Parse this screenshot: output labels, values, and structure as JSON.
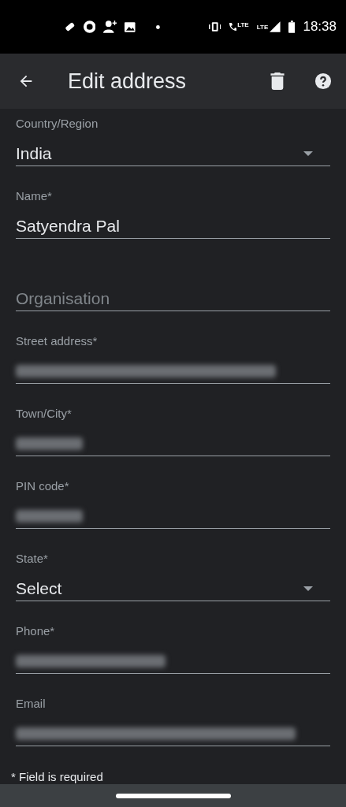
{
  "status_bar": {
    "network_labels": [
      "LTE",
      "LTE"
    ],
    "time": "18:38"
  },
  "app_bar": {
    "title": "Edit address"
  },
  "fields": [
    {
      "kind": "dropdown",
      "label": "Country/Region",
      "value": "India"
    },
    {
      "kind": "text",
      "label": "Name*",
      "value": "Satyendra Pal"
    },
    {
      "kind": "text",
      "placeholder": "Organisation"
    },
    {
      "kind": "text",
      "label": "Street address*",
      "blurred": true
    },
    {
      "kind": "text",
      "label": "Town/City*",
      "blurred": true
    },
    {
      "kind": "text",
      "label": "PIN code*",
      "blurred": true
    },
    {
      "kind": "dropdown",
      "label": "State*",
      "value": "Select"
    },
    {
      "kind": "text",
      "label": "Phone*",
      "blurred": true
    },
    {
      "kind": "text",
      "label": "Email",
      "blurred": true
    }
  ],
  "footnote": "* Field is required"
}
